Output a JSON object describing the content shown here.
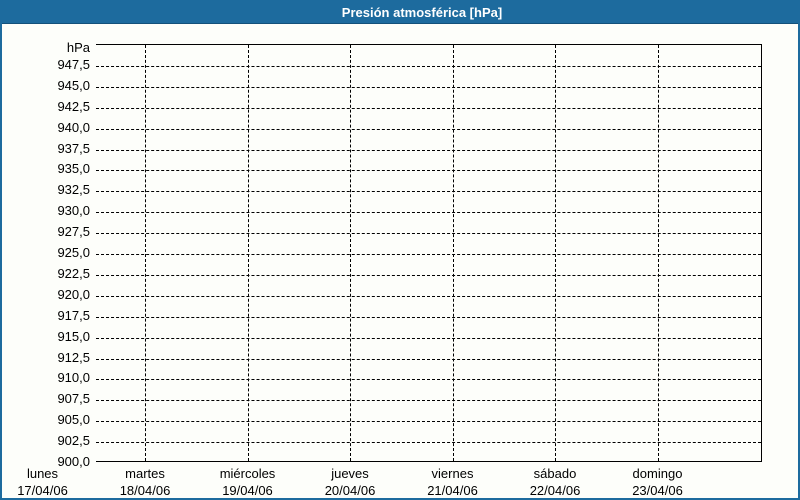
{
  "title": "Presión atmosférica [hPa]",
  "y_axis": {
    "unit": "hPa",
    "labels": [
      "947,5",
      "945,0",
      "942,5",
      "940,0",
      "937,5",
      "935,0",
      "932,5",
      "930,0",
      "927,5",
      "925,0",
      "922,5",
      "920,0",
      "917,5",
      "915,0",
      "912,5",
      "910,0",
      "907,5",
      "905,0",
      "902,5",
      "900,0"
    ]
  },
  "x_axis": {
    "days": [
      {
        "name": "lunes",
        "date": "17/04/06"
      },
      {
        "name": "martes",
        "date": "18/04/06"
      },
      {
        "name": "miércoles",
        "date": "19/04/06"
      },
      {
        "name": "jueves",
        "date": "20/04/06"
      },
      {
        "name": "viernes",
        "date": "21/04/06"
      },
      {
        "name": "sábado",
        "date": "22/04/06"
      },
      {
        "name": "domingo",
        "date": "23/04/06"
      }
    ]
  },
  "colors": {
    "accent_blue": "#1d6b9e",
    "title_text": "#ffffff",
    "grid": "#000000",
    "background": "#fdfefa"
  },
  "chart_data": {
    "type": "line",
    "title": "Presión atmosférica [hPa]",
    "ylabel": "hPa",
    "ylim": [
      900.0,
      950.0
    ],
    "ytick_step": 2.5,
    "ytick_labels_shown": [
      "947,5",
      "945,0",
      "942,5",
      "940,0",
      "937,5",
      "935,0",
      "932,5",
      "930,0",
      "927,5",
      "925,0",
      "922,5",
      "920,0",
      "917,5",
      "915,0",
      "912,5",
      "910,0",
      "907,5",
      "905,0",
      "902,5",
      "900,0"
    ],
    "x": [
      "lunes 17/04/06",
      "martes 18/04/06",
      "miércoles 19/04/06",
      "jueves 20/04/06",
      "viernes 21/04/06",
      "sábado 22/04/06",
      "domingo 23/04/06"
    ],
    "series": [],
    "grid": true,
    "grid_style": "dashed",
    "legend": "none"
  }
}
